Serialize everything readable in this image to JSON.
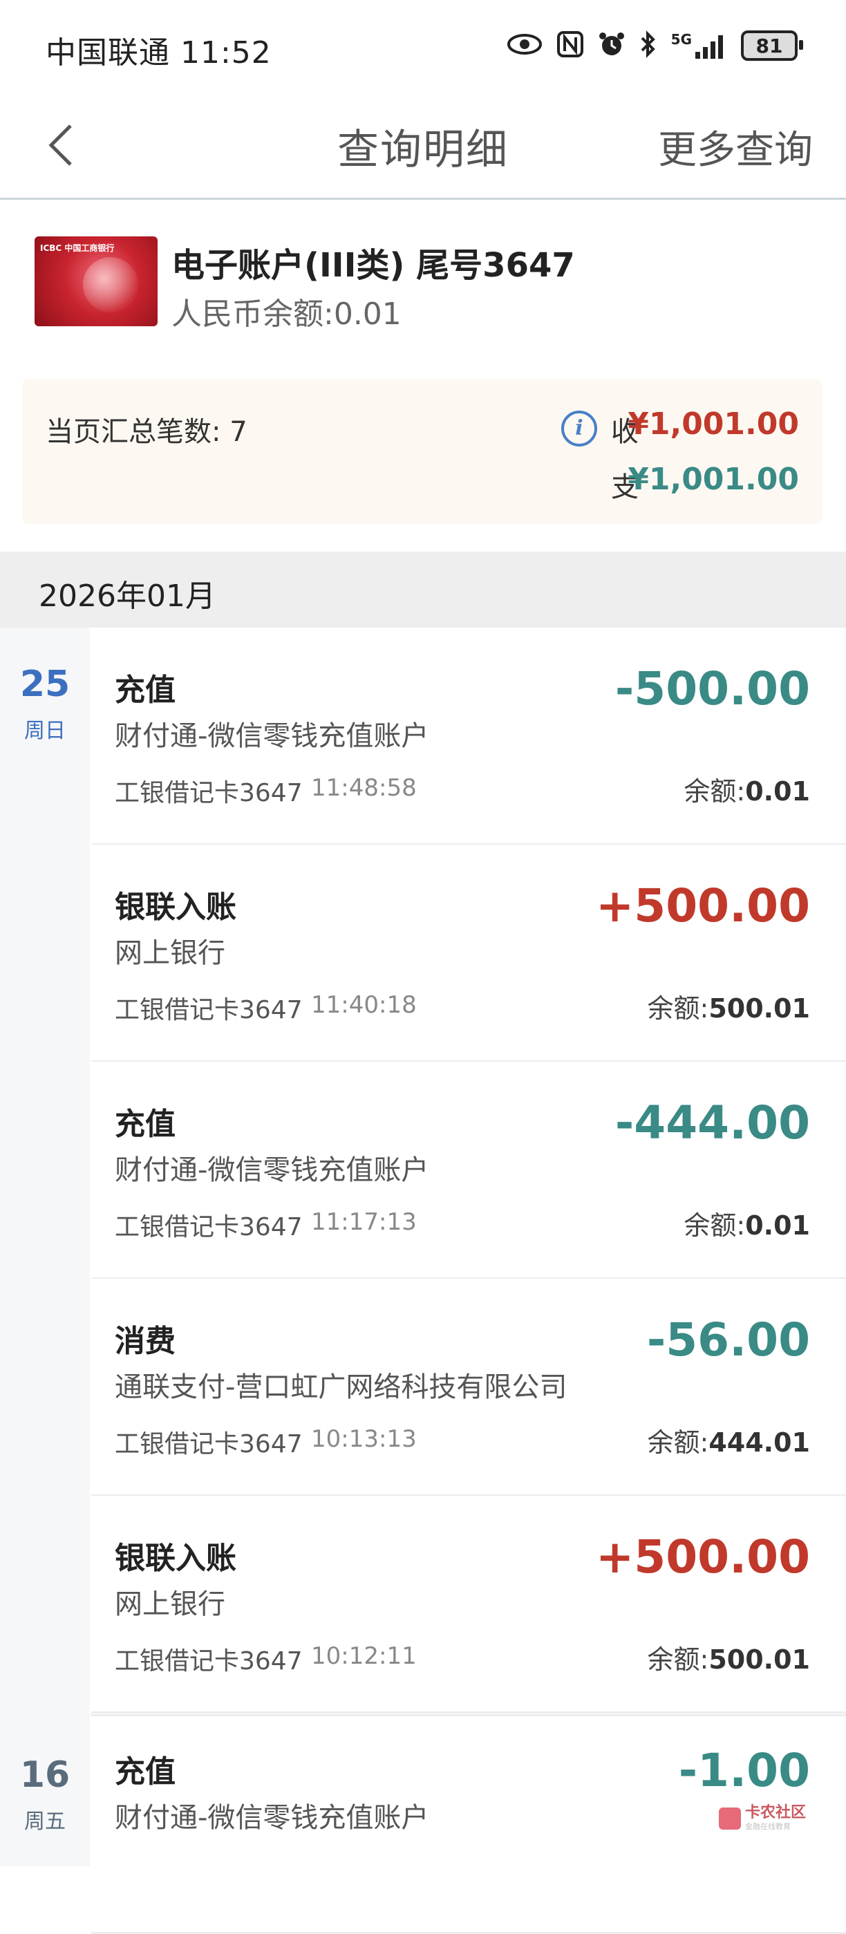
{
  "status_bar": {
    "carrier_time": "中国联通 11:52",
    "network": "5G",
    "battery": "81"
  },
  "nav": {
    "title": "查询明细",
    "more": "更多查询"
  },
  "account": {
    "card_logo": "ICBC 中国工商银行",
    "name": "电子账户(III类) 尾号3647",
    "balance": "人民币余额:0.01"
  },
  "summary": {
    "count": "当页汇总笔数: 7",
    "in_label": "收",
    "in_amount": "¥1,001.00",
    "out_label": "支",
    "out_amount": "¥1,001.00",
    "in_color": "#c0392b",
    "out_color": "#3a8a86"
  },
  "month": "2026年01月",
  "days": [
    {
      "day": "25",
      "weekday": "周日",
      "color": "#3c6fbf"
    },
    {
      "day": "16",
      "weekday": "周五",
      "color": "#5a6c7c"
    }
  ],
  "transactions": [
    {
      "type": "充值",
      "party": "财付通-微信零钱充值账户",
      "card": "工银借记卡3647",
      "time": "11:48:58",
      "amount": "-500.00",
      "balance_label": "余额:",
      "balance": "0.01"
    },
    {
      "type": "银联入账",
      "party": "网上银行",
      "card": "工银借记卡3647",
      "time": "11:40:18",
      "amount": "+500.00",
      "balance_label": "余额:",
      "balance": "500.01"
    },
    {
      "type": "充值",
      "party": "财付通-微信零钱充值账户",
      "card": "工银借记卡3647",
      "time": "11:17:13",
      "amount": "-444.00",
      "balance_label": "余额:",
      "balance": "0.01"
    },
    {
      "type": "消费",
      "party": "通联支付-营口虹广网络科技有限公司",
      "card": "工银借记卡3647",
      "time": "10:13:13",
      "amount": "-56.00",
      "balance_label": "余额:",
      "balance": "444.01"
    },
    {
      "type": "银联入账",
      "party": "网上银行",
      "card": "工银借记卡3647",
      "time": "10:12:11",
      "amount": "+500.00",
      "balance_label": "余额:",
      "balance": "500.01"
    },
    {
      "type": "充值",
      "party": "财付通-微信零钱充值账户",
      "card": "工银借记卡3647",
      "time": "",
      "amount": "-1.00",
      "balance_label": "",
      "balance": ""
    }
  ],
  "watermark": {
    "text": "卡农社区",
    "sub": "金融在线教育"
  }
}
